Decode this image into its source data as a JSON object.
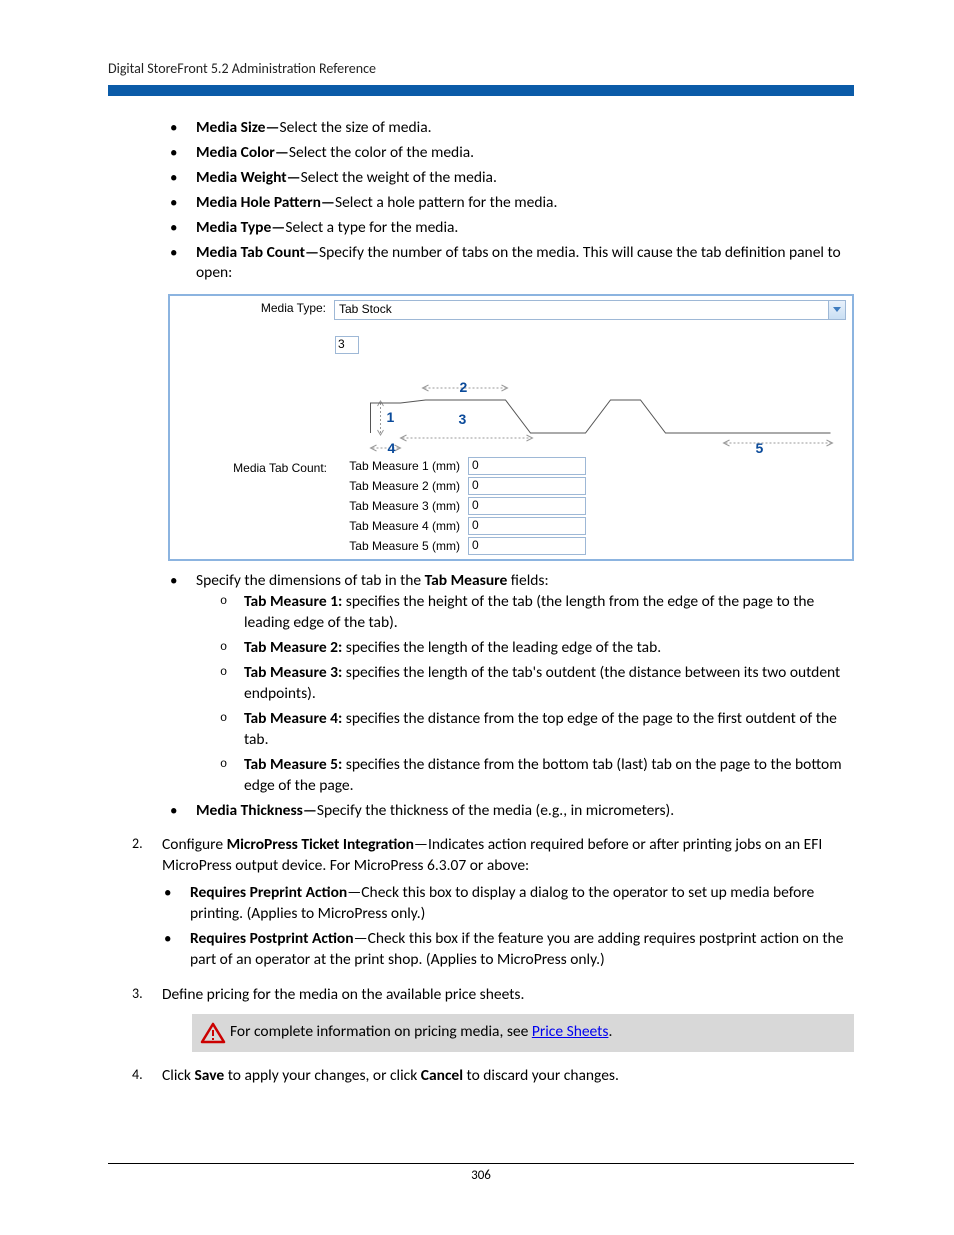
{
  "header": {
    "title": "Digital StoreFront 5.2 Administration Reference"
  },
  "bullets": {
    "mediaSize": {
      "label": "Media Size—",
      "text": "Select the size of media."
    },
    "mediaColor": {
      "label": "Media Color—",
      "text": "Select the color of the media."
    },
    "mediaWeight": {
      "label": "Media Weight—",
      "text": "Select the weight of the media."
    },
    "mediaHole": {
      "label": "Media Hole Pattern—",
      "text": "Select a hole pattern for the media."
    },
    "mediaType": {
      "label": "Media Type—",
      "text": "Select a type for the media."
    },
    "mediaTab": {
      "label": "Media Tab Count—",
      "text": "Specify the number of tabs on the media. This will cause the tab definition panel to open:"
    },
    "specifyTab": "Specify the dimensions of tab in the ",
    "tabMeasure": "Tab Measure",
    "fields": " fields:",
    "tm1": {
      "label": "Tab Measure 1:",
      "text": " specifies the height of the tab (the length from the edge of the page to the leading edge of the tab)."
    },
    "tm2": {
      "label": "Tab Measure 2:",
      "text": " specifies the length of the leading edge of the tab."
    },
    "tm3": {
      "label": "Tab Measure 3:",
      "text": " specifies the length of the tab's outdent (the distance between its two outdent endpoints)."
    },
    "tm4": {
      "label": "Tab Measure 4:",
      "text": " specifies the distance from the top edge of the page to the first outdent of the tab."
    },
    "tm5": {
      "label": "Tab Measure 5:",
      "text": " specifies the distance from the bottom tab (last) tab on the page to the bottom edge of the page."
    },
    "mediaThick": {
      "label": "Media Thickness—",
      "text": "Specify the thickness of the media (e.g., in micrometers)."
    }
  },
  "panel": {
    "mediaTypeLabel": "Media Type:",
    "mediaTypeValue": "Tab Stock",
    "mediaTabCountLabel": "Media Tab Count:",
    "tabCountValue": "3",
    "diagram": {
      "n1": "1",
      "n2": "2",
      "n3": "3",
      "n4": "4",
      "n5": "5"
    },
    "measures": [
      {
        "label": "Tab Measure 1 (mm)",
        "value": "0"
      },
      {
        "label": "Tab Measure 2 (mm)",
        "value": "0"
      },
      {
        "label": "Tab Measure 3 (mm)",
        "value": "0"
      },
      {
        "label": "Tab Measure 4 (mm)",
        "value": "0"
      },
      {
        "label": "Tab Measure 5 (mm)",
        "value": "0"
      }
    ]
  },
  "steps": {
    "s2": {
      "num": "2.",
      "lead": "Configure ",
      "bold": "MicroPress Ticket Integration",
      "dash": "—Indicates action required before or after printing jobs on an EFI MicroPress output device. For MicroPress 6.3.07 or above:",
      "pre": {
        "label": "Requires Preprint Action",
        "text": "—Check this box to display a dialog to the operator to set up media before printing. (Applies to MicroPress only.)"
      },
      "post": {
        "label": "Requires Postprint Action",
        "text": "—Check this box if the feature you are adding requires postprint action on the part of an operator at the print shop. (Applies to MicroPress only.)"
      }
    },
    "s3": {
      "num": "3.",
      "text": "Define pricing for the media on the available price sheets."
    },
    "callout": {
      "before": "For complete information on pricing media, see ",
      "link": "Price Sheets",
      "after": "."
    },
    "s4": {
      "num": "4.",
      "t1": "Click ",
      "b1": "Save",
      "t2": " to apply your changes, or click ",
      "b2": "Cancel",
      "t3": " to discard your changes."
    }
  },
  "footer": {
    "page": "306"
  }
}
